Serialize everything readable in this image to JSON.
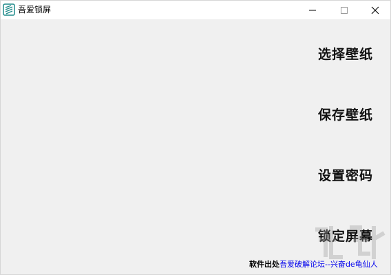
{
  "window": {
    "title": "吾爱锁屏",
    "app_icon": "app-logo-icon",
    "controls": {
      "minimize_icon": "minimize-icon",
      "maximize_icon": "maximize-icon",
      "close_icon": "close-icon"
    }
  },
  "actions": [
    {
      "label": "选择壁纸"
    },
    {
      "label": "保存壁纸"
    },
    {
      "label": "设置密码"
    },
    {
      "label": "锁定屏幕"
    }
  ],
  "footer": {
    "prefix": "软件出处",
    "link_text": "吾爱破解论坛--兴奋de龟仙人"
  },
  "colors": {
    "background": "#f0f0f0",
    "titlebar": "#ffffff",
    "link": "#0000ee",
    "icon_teal": "#1f8a8a"
  }
}
